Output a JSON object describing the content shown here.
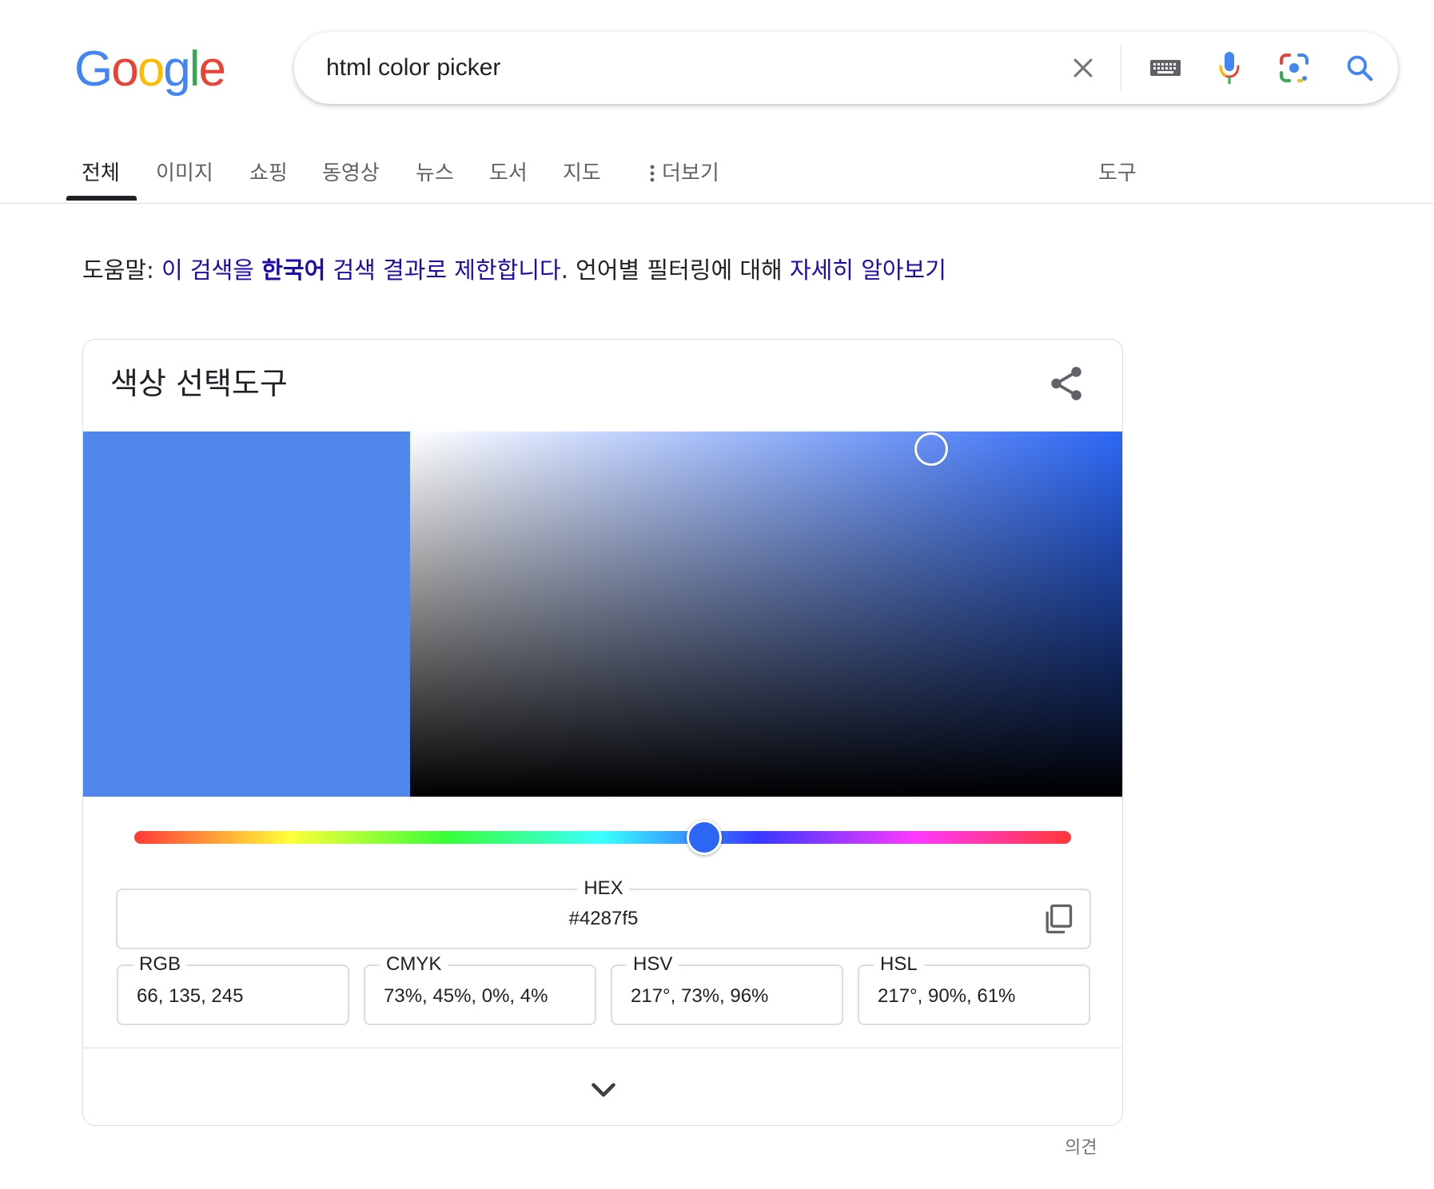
{
  "logo": {
    "letters": [
      "G",
      "o",
      "o",
      "g",
      "l",
      "e"
    ],
    "colors": [
      "#4285f4",
      "#ea4335",
      "#fbbc05",
      "#4285f4",
      "#34a853",
      "#ea4335"
    ]
  },
  "search": {
    "query": "html color picker",
    "icons": [
      "close-icon",
      "keyboard-icon",
      "mic-icon",
      "lens-icon",
      "search-icon"
    ]
  },
  "tabs": {
    "items": [
      "전체",
      "이미지",
      "쇼핑",
      "동영상",
      "뉴스",
      "도서",
      "지도"
    ],
    "more": "더보기",
    "tools": "도구",
    "active": "전체"
  },
  "help": {
    "prefix": "도움말:",
    "link1a": "이 검색을",
    "link1b": "한국어",
    "link1c": "검색 결과로 제한합니다",
    "middle": ". 언어별 필터링에 대해",
    "link2": "자세히 알아보기"
  },
  "picker": {
    "title": "색상 선택도구",
    "selected_color": "#5087ed",
    "hue_color": "#2b66f5",
    "hex": {
      "label": "HEX",
      "value": "#4287f5"
    },
    "rgb": {
      "label": "RGB",
      "value": "66, 135, 245"
    },
    "cmyk": {
      "label": "CMYK",
      "value": "73%, 45%, 0%, 4%"
    },
    "hsv": {
      "label": "HSV",
      "value": "217°, 73%, 96%"
    },
    "hsl": {
      "label": "HSL",
      "value": "217°, 90%, 61%"
    }
  },
  "feedback": "의견"
}
